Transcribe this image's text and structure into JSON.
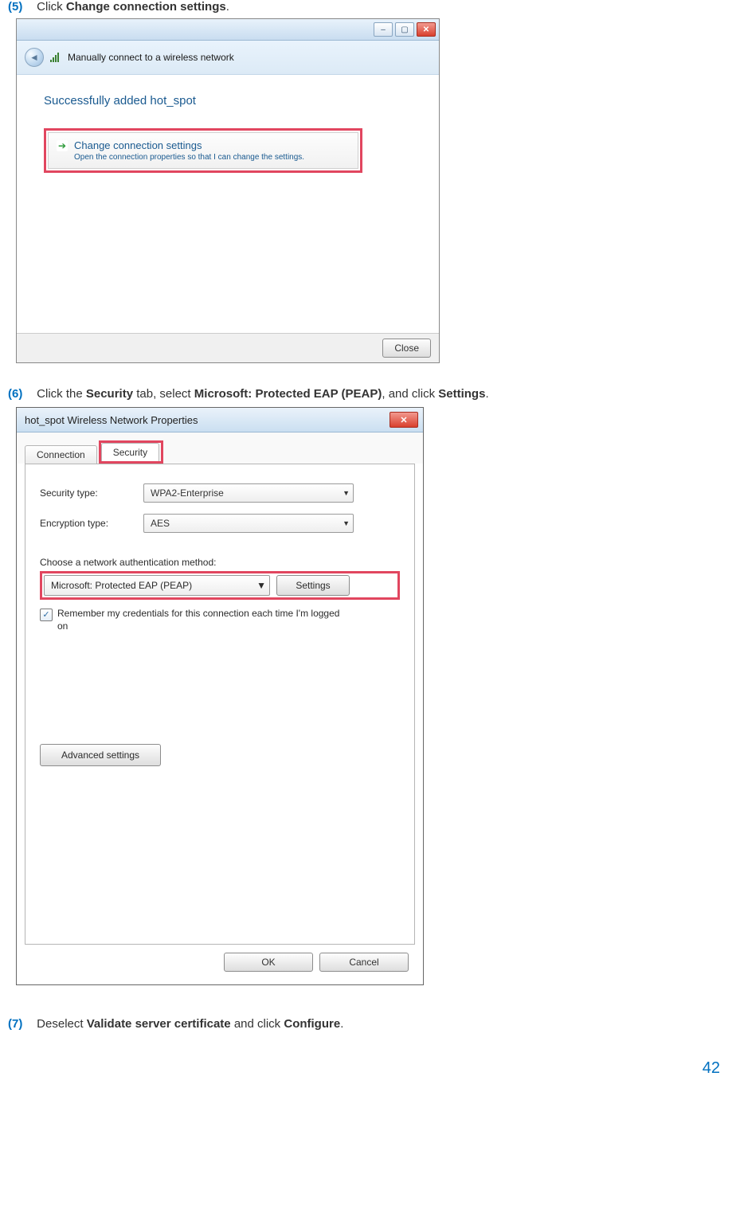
{
  "step5": {
    "num": "(5)",
    "text_before": "Click ",
    "bold": "Change connection settings",
    "text_after": "."
  },
  "step6": {
    "num": "(6)",
    "parts": [
      "Click the ",
      "Security",
      " tab, select ",
      "Microsoft: Protected EAP (PEAP)",
      ", and click ",
      "Settings",
      "."
    ]
  },
  "step7": {
    "num": "(7)",
    "parts": [
      "Deselect ",
      "Validate server certificate",
      " and click ",
      "Configure",
      "."
    ]
  },
  "win1": {
    "header": "Manually connect to a wireless network",
    "success": "Successfully added hot_spot",
    "change_title": "Change connection settings",
    "change_sub": "Open the connection properties so that I can change the settings.",
    "close": "Close"
  },
  "win2": {
    "title": "hot_spot Wireless Network Properties",
    "tab_connection": "Connection",
    "tab_security": "Security",
    "sec_type_label": "Security type:",
    "sec_type_value": "WPA2-Enterprise",
    "enc_type_label": "Encryption type:",
    "enc_type_value": "AES",
    "auth_label": "Choose a network authentication method:",
    "auth_value": "Microsoft: Protected EAP (PEAP)",
    "settings_btn": "Settings",
    "remember": "Remember my credentials for this connection each time I'm logged on",
    "advanced": "Advanced settings",
    "ok": "OK",
    "cancel": "Cancel"
  },
  "page_number": "42"
}
